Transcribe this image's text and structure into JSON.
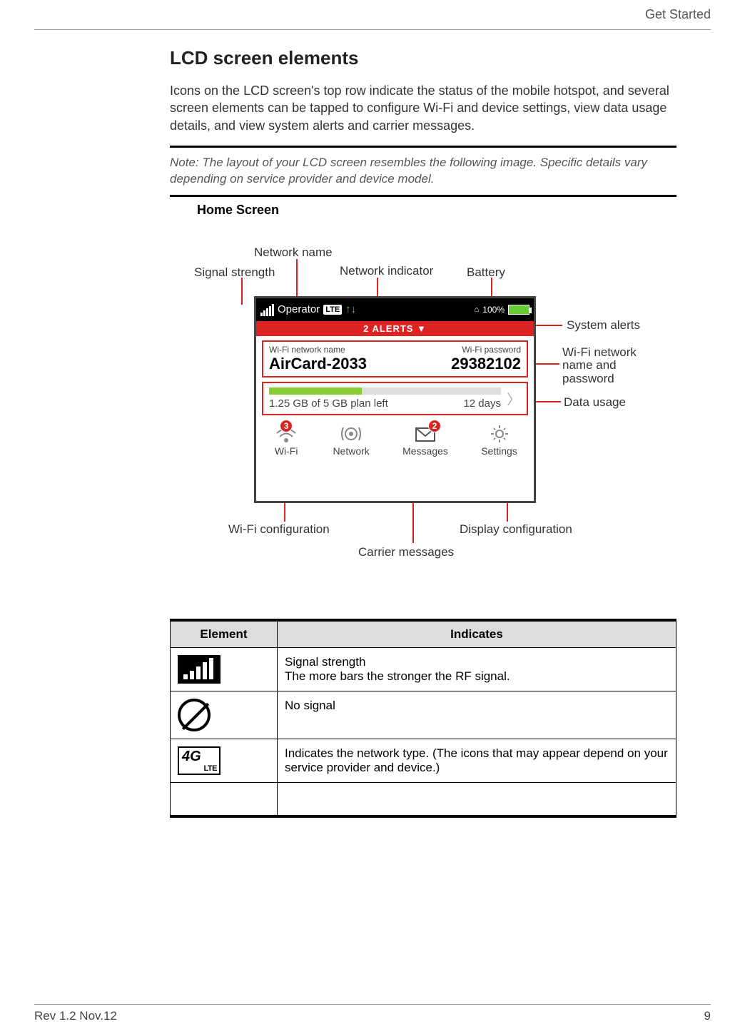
{
  "header": {
    "section": "Get Started"
  },
  "title": "LCD screen elements",
  "intro": "Icons on the LCD screen's top row indicate the status of the mobile hotspot, and several screen elements can be tapped to configure Wi-Fi and device settings, view data usage details, and view system alerts and carrier messages.",
  "note_prefix": "Note:  ",
  "note": "The layout of your LCD screen resembles the following image. Specific details vary depending on service provider and device model.",
  "home_title": "Home Screen",
  "callouts": {
    "signal": "Signal strength",
    "network_name": "Network name",
    "network_ind": "Network indicator",
    "battery": "Battery",
    "sys_alerts": "System alerts",
    "wifi_cred": "Wi-Fi network name and password",
    "data_usage": "Data usage",
    "wifi_conf": "Wi-Fi configuration",
    "carrier_msg": "Carrier messages",
    "display_conf": "Display configuration"
  },
  "lcd": {
    "operator": "Operator",
    "lte": "LTE",
    "battery_pct": "100%",
    "alerts_bar": "2 ALERTS  ▼",
    "wifi_name_label": "Wi-Fi network name",
    "wifi_pass_label": "Wi-Fi password",
    "wifi_name": "AirCard-2033",
    "wifi_pass": "29382102",
    "data_left": "1.25 GB of 5 GB plan left",
    "data_days": "12 days",
    "nav": {
      "wifi": "Wi-Fi",
      "network": "Network",
      "messages": "Messages",
      "settings": "Settings",
      "wifi_badge": "3",
      "msg_badge": "2"
    }
  },
  "table": {
    "h1": "Element",
    "h2": "Indicates",
    "rows": [
      {
        "desc_line1": "Signal strength",
        "desc_line2": "The more bars the stronger the RF signal."
      },
      {
        "desc_line1": "No signal",
        "desc_line2": ""
      },
      {
        "desc_line1": "Indicates the network type. (The icons that may appear depend on your service provider and device.)",
        "desc_line2": ""
      },
      {
        "desc_line1": "",
        "desc_line2": ""
      }
    ]
  },
  "footer": {
    "rev": "Rev 1.2  Nov.12",
    "page": "9"
  }
}
